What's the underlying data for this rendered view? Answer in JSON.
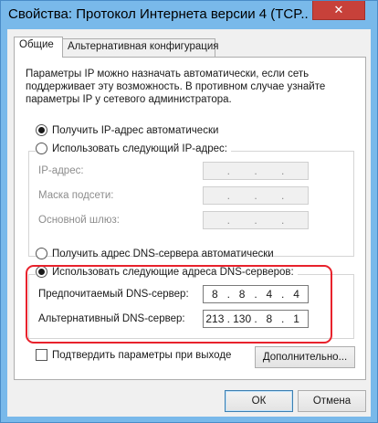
{
  "window": {
    "title": "Свойства: Протокол Интернета версии 4 (TCP...",
    "close_glyph": "✕"
  },
  "tabs": [
    {
      "label": "Общие",
      "active": true
    },
    {
      "label": "Альтернативная конфигурация",
      "active": false
    }
  ],
  "description": {
    "lines": [
      "Параметры IP можно назначать автоматически, если сеть",
      "поддерживает эту возможность. В противном случае узнайте",
      "параметры IP у сетевого администратора."
    ]
  },
  "ip": {
    "auto_label": "Получить IP-адрес автоматически",
    "manual_label": "Использовать следующий IP-адрес:",
    "fields": [
      {
        "label": "IP-адрес:",
        "octets": [
          "",
          "",
          "",
          ""
        ]
      },
      {
        "label": "Маска подсети:",
        "octets": [
          "",
          "",
          "",
          ""
        ]
      },
      {
        "label": "Основной шлюз:",
        "octets": [
          "",
          "",
          "",
          ""
        ]
      }
    ]
  },
  "dns": {
    "auto_label": "Получить адрес DNS-сервера автоматически",
    "manual_label": "Использовать следующие адреса DNS-серверов:",
    "preferred": {
      "label": "Предпочитаемый DNS-сервер:",
      "octets": [
        "8",
        "8",
        "4",
        "4"
      ]
    },
    "alternate": {
      "label": "Альтернативный DNS-сервер:",
      "octets": [
        "213",
        "130",
        "8",
        "1"
      ]
    }
  },
  "validate": {
    "label": "Подтвердить параметры при выходе",
    "checked": false
  },
  "buttons": {
    "advanced": "Дополнительно...",
    "ok": "ОК",
    "cancel": "Отмена"
  },
  "colors": {
    "titlebar": "#79b9ea",
    "close_button": "#c7413a",
    "highlight": "#e8222c"
  }
}
